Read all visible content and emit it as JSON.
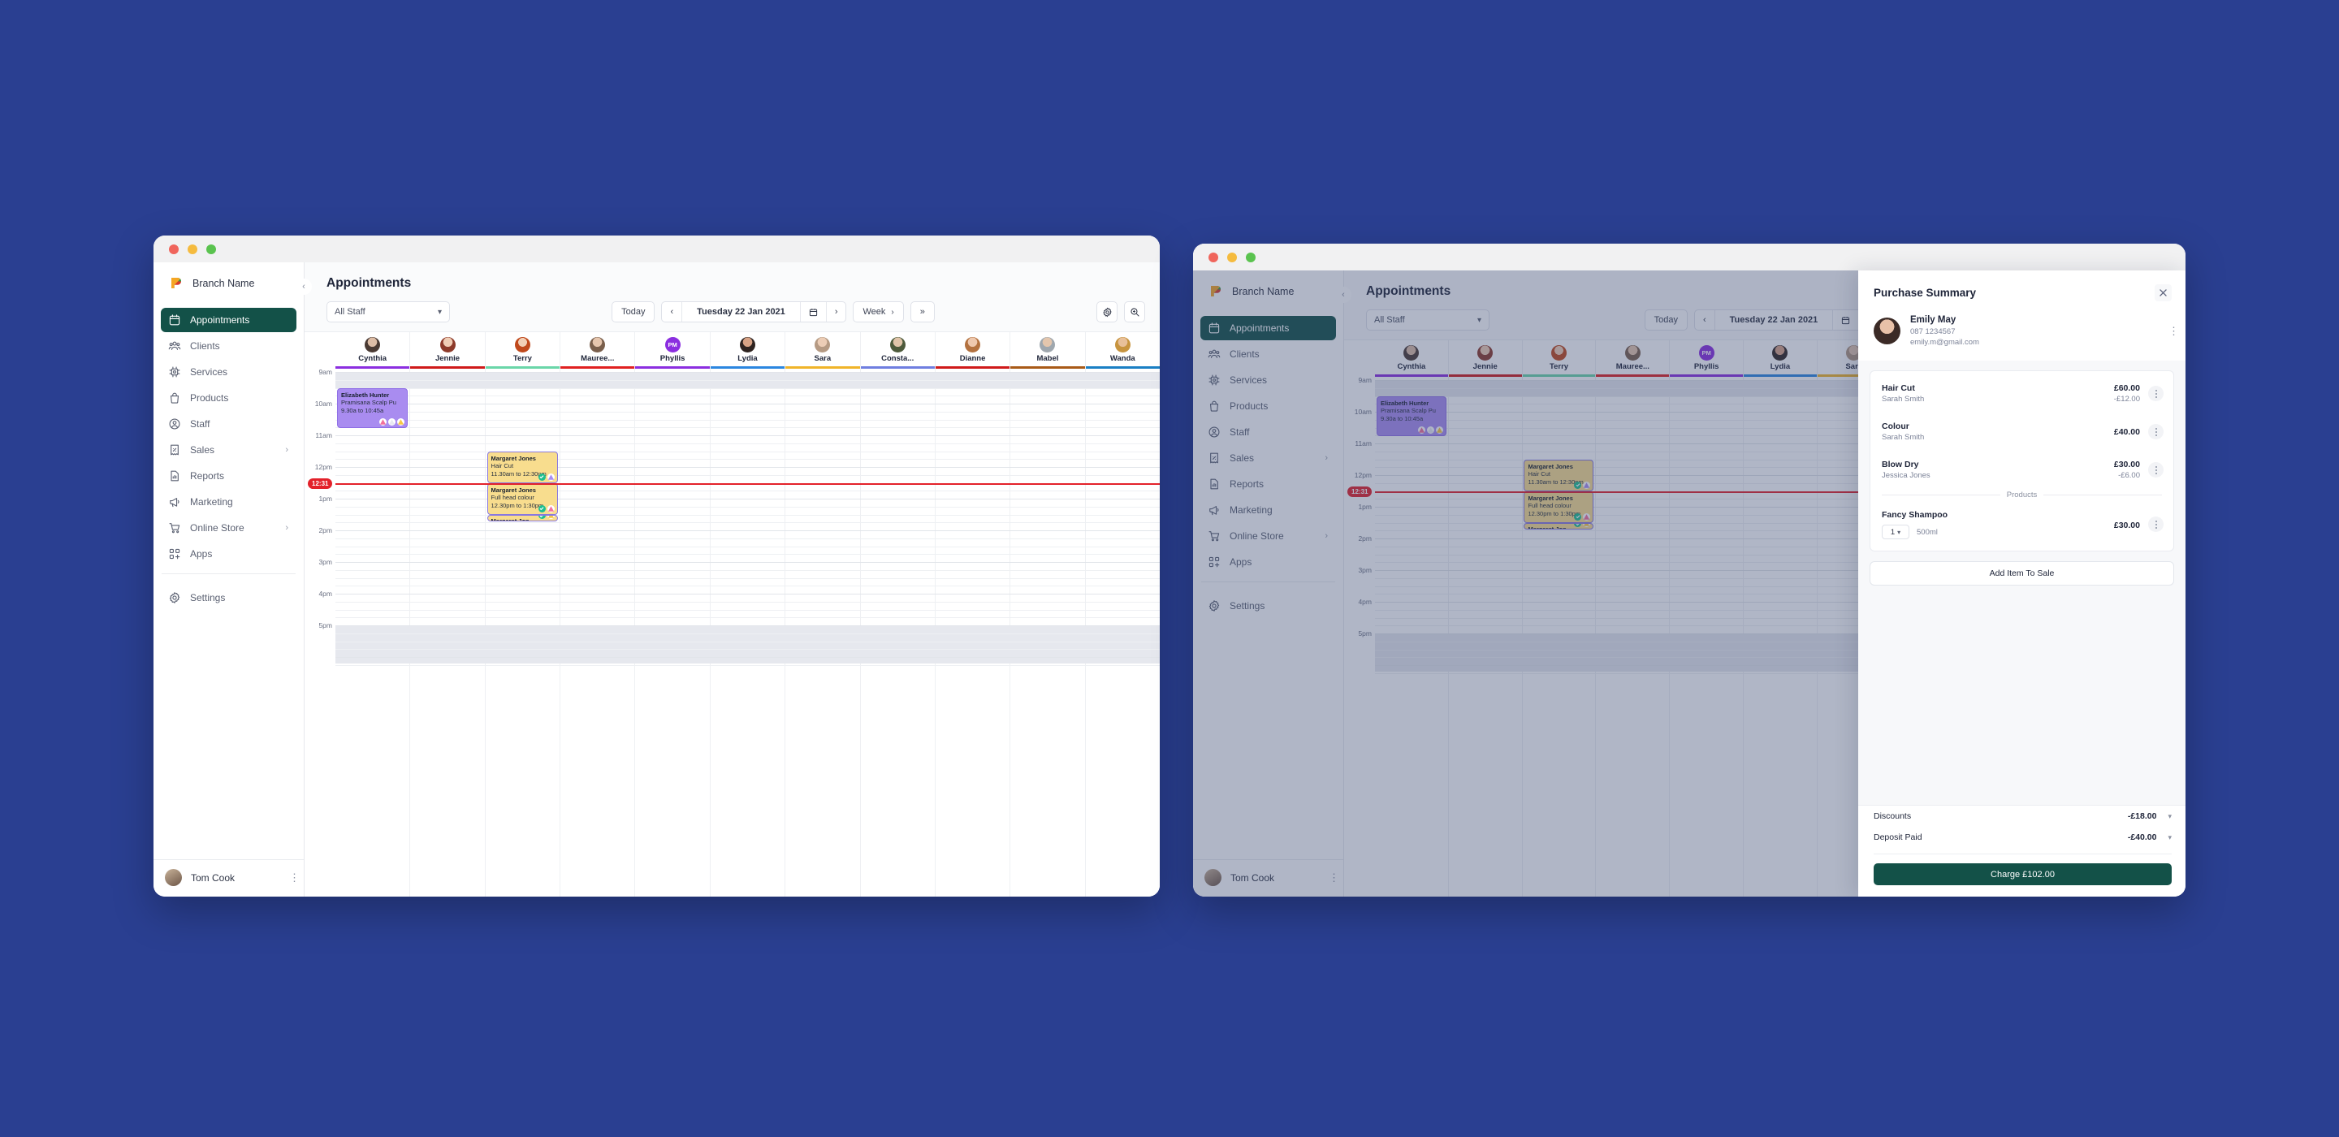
{
  "background_color": "#2a3f91",
  "accent_color": "#135148",
  "app": {
    "brand": "Branch Name",
    "page_title": "Appointments",
    "user": {
      "name": "Tom Cook"
    }
  },
  "sidebar": {
    "items": [
      {
        "label": "Appointments",
        "icon": "calendar-icon",
        "active": true,
        "chevron": false
      },
      {
        "label": "Clients",
        "icon": "users-icon",
        "active": false,
        "chevron": false
      },
      {
        "label": "Services",
        "icon": "services-icon",
        "active": false,
        "chevron": false
      },
      {
        "label": "Products",
        "icon": "bag-icon",
        "active": false,
        "chevron": false
      },
      {
        "label": "Staff",
        "icon": "user-icon",
        "active": false,
        "chevron": false
      },
      {
        "label": "Sales",
        "icon": "receipt-icon",
        "active": false,
        "chevron": true
      },
      {
        "label": "Reports",
        "icon": "chart-icon",
        "active": false,
        "chevron": false
      },
      {
        "label": "Marketing",
        "icon": "megaphone-icon",
        "active": false,
        "chevron": false
      },
      {
        "label": "Online Store",
        "icon": "cart-icon",
        "active": false,
        "chevron": true
      },
      {
        "label": "Apps",
        "icon": "apps-icon",
        "active": false,
        "chevron": false
      }
    ],
    "settings": {
      "label": "Settings",
      "icon": "gear-icon"
    }
  },
  "toolbar": {
    "staff_filter": "All Staff",
    "today_label": "Today",
    "prev_label": "‹",
    "next_label": "›",
    "date_label": "Tuesday 22 Jan 2021",
    "view_label": "Week",
    "expand_label": "»",
    "settings_icon": "gear-icon",
    "zoom_icon": "zoom-in-icon"
  },
  "calendar": {
    "now_time": "12:31",
    "time_labels": [
      "9am",
      "10am",
      "11am",
      "12pm",
      "1pm",
      "2pm",
      "3pm",
      "4pm",
      "5pm"
    ],
    "columns": [
      {
        "name": "Cynthia",
        "color": "#8b2ee0",
        "initials": ""
      },
      {
        "name": "Jennie",
        "color": "#cf1a1a",
        "initials": ""
      },
      {
        "name": "Terry",
        "color": "#6ad6a8",
        "initials": ""
      },
      {
        "name": "Mauree...",
        "color": "#e02020",
        "initials": ""
      },
      {
        "name": "Phyllis",
        "color": "#8b2ee0",
        "initials": "PM"
      },
      {
        "name": "Lydia",
        "color": "#2b86e0",
        "initials": ""
      },
      {
        "name": "Sara",
        "color": "#f0b429",
        "initials": ""
      },
      {
        "name": "Consta...",
        "color": "#6f7ee0",
        "initials": ""
      },
      {
        "name": "Dianne",
        "color": "#cf1a1a",
        "initials": ""
      },
      {
        "name": "Mabel",
        "color": "#a85a17",
        "initials": ""
      },
      {
        "name": "Wanda",
        "color": "#1a7fc4",
        "initials": ""
      }
    ],
    "appointments": [
      {
        "client": "Elizabeth Hunter",
        "service": "Pramisana Scalp Pu",
        "time": "9.30a to 10:45a",
        "column": 0,
        "color": "purple",
        "size": "large",
        "badges": [
          "pink",
          "white",
          "yellow"
        ]
      },
      {
        "client": "Margaret Jones",
        "service": "Hair Cut",
        "time": "11.30am to 12:30pm",
        "column": 2,
        "color": "yellow",
        "size": "large",
        "badges": [
          "green-check",
          "purple"
        ]
      },
      {
        "client": "Margaret Jones",
        "service": "Full head colour",
        "time": "12.30pm to 1:30pm",
        "column": 2,
        "color": "yellow",
        "size": "large",
        "badges": [
          "green-check",
          "pink"
        ]
      },
      {
        "client": "Margaret Jon...",
        "service": "",
        "time": "",
        "column": 2,
        "color": "yellow",
        "size": "tiny",
        "badges": [
          "green-check",
          "yellow"
        ]
      }
    ]
  },
  "panel": {
    "title": "Purchase Summary",
    "close_icon": "close-icon",
    "client": {
      "name": "Emily May",
      "phone": "087 1234567",
      "email": "emily.m@gmail.com"
    },
    "services": [
      {
        "name": "Hair Cut",
        "staff": "Sarah Smith",
        "price": "£60.00",
        "discount": "-£12.00"
      },
      {
        "name": "Colour",
        "staff": "Sarah Smith",
        "price": "£40.00",
        "discount": ""
      },
      {
        "name": "Blow Dry",
        "staff": "Jessica Jones",
        "price": "£30.00",
        "discount": "-£6.00"
      }
    ],
    "products_divider": "Products",
    "products": [
      {
        "name": "Fancy Shampoo",
        "qty": "1",
        "size": "500ml",
        "price": "£30.00"
      }
    ],
    "add_item_label": "Add  Item To Sale",
    "totals": [
      {
        "label": "Discounts",
        "value": "-£18.00"
      },
      {
        "label": "Deposit Paid",
        "value": "-£40.00"
      }
    ],
    "charge_label": "Charge £102.00"
  }
}
